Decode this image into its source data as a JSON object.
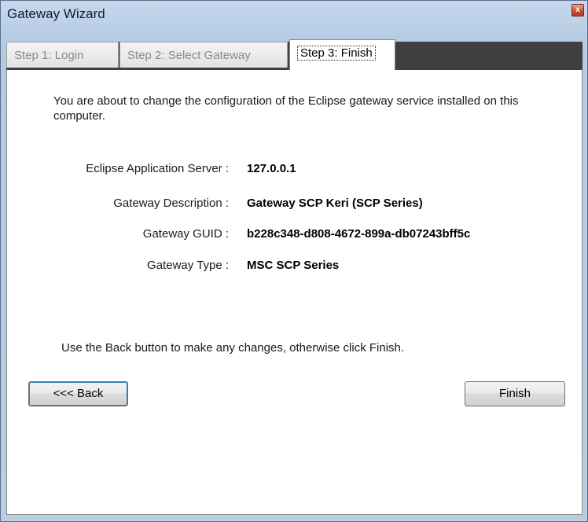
{
  "window": {
    "title": "Gateway Wizard",
    "close_glyph": "x"
  },
  "tabs": [
    {
      "label": "Step 1: Login"
    },
    {
      "label": "Step 2: Select Gateway"
    },
    {
      "label": "Step 3: Finish"
    }
  ],
  "content": {
    "intro": "You are about to change the configuration of the Eclipse gateway service installed on this computer.",
    "fields": [
      {
        "label": "Eclipse Application Server :",
        "value": "127.0.0.1"
      },
      {
        "label": "Gateway Description :",
        "value": "Gateway SCP Keri (SCP Series)"
      },
      {
        "label": "Gateway GUID :",
        "value": "b228c348-d808-4672-899a-db07243bff5c"
      },
      {
        "label": "Gateway Type :",
        "value": "MSC SCP Series"
      }
    ],
    "hint": "Use the Back button to make any changes, otherwise click Finish."
  },
  "buttons": {
    "back": "<<< Back",
    "finish": "Finish"
  }
}
